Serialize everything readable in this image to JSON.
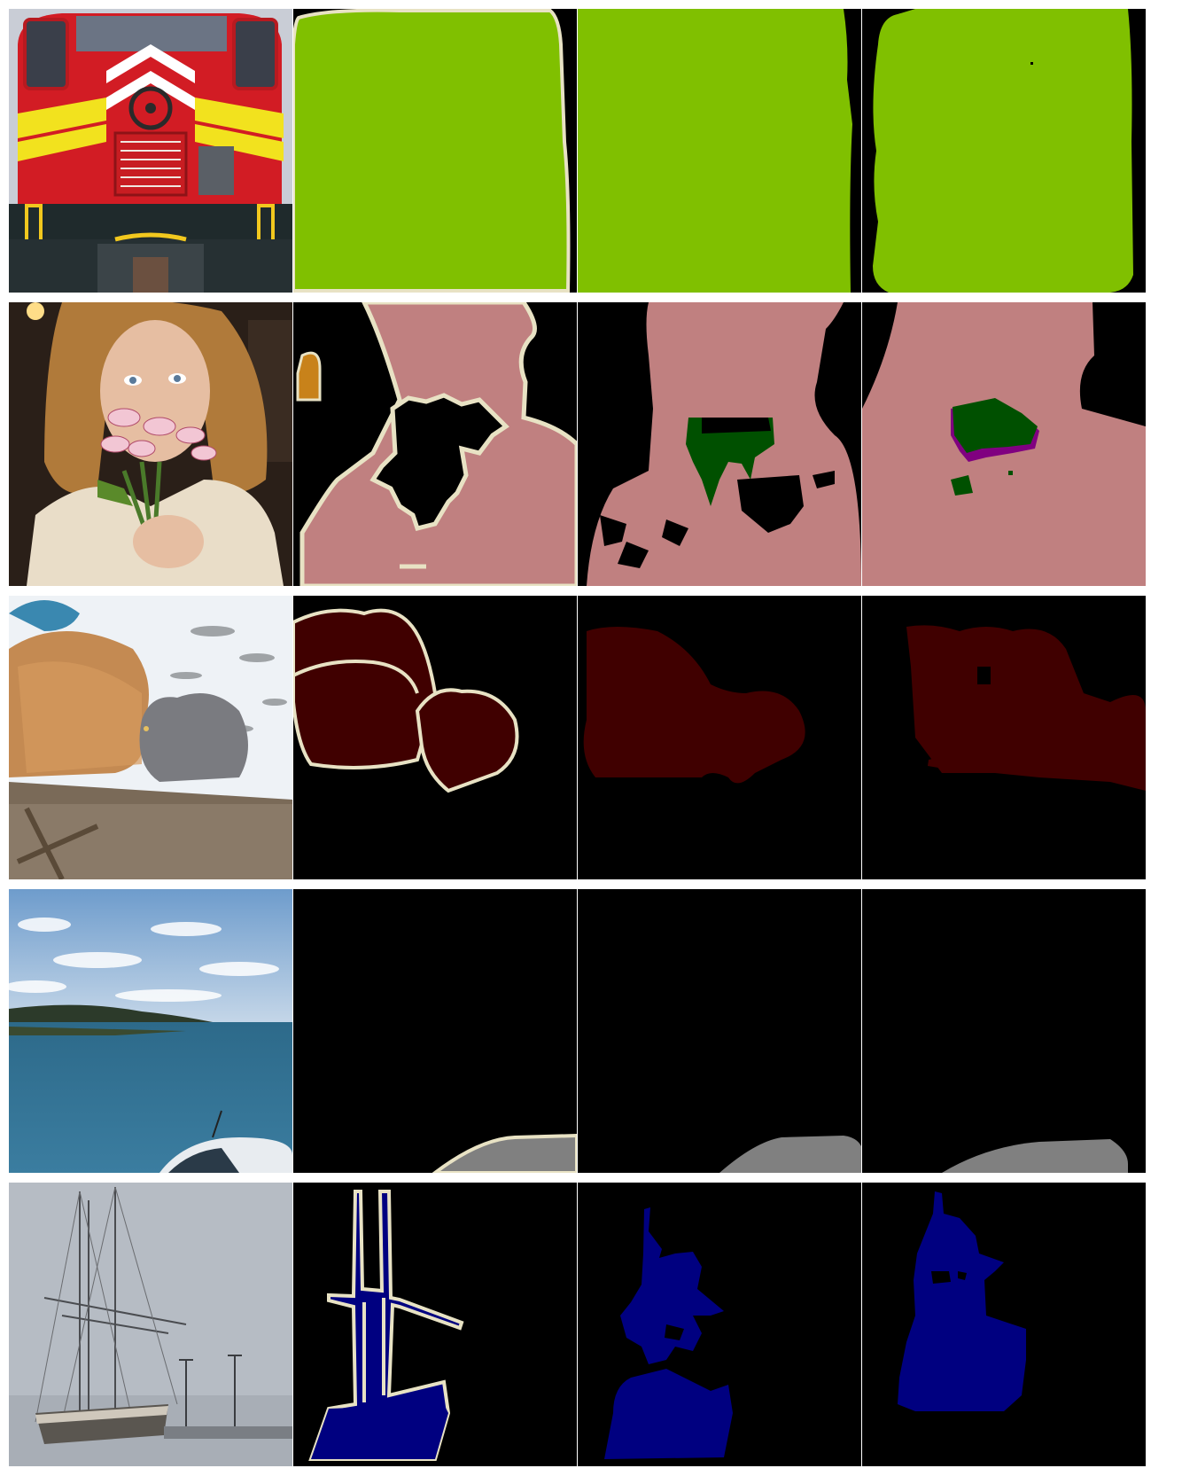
{
  "figure": {
    "rows": [
      {
        "name": "locomotive",
        "class_color": "#80c000"
      },
      {
        "name": "person-with-flowers",
        "class_color": "#c08080",
        "secondary_colors": [
          "#005000",
          "#800080"
        ]
      },
      {
        "name": "cats-in-snow",
        "class_color": "#400000"
      },
      {
        "name": "seascape-with-car",
        "class_color": "#808080"
      },
      {
        "name": "sailing-ship",
        "class_color": "#000080"
      }
    ],
    "columns": [
      "input-image",
      "ground-truth-mask",
      "prediction-a-mask",
      "prediction-b-mask"
    ],
    "boundary_color": "#e8e2c4",
    "background_color": "#000000"
  }
}
